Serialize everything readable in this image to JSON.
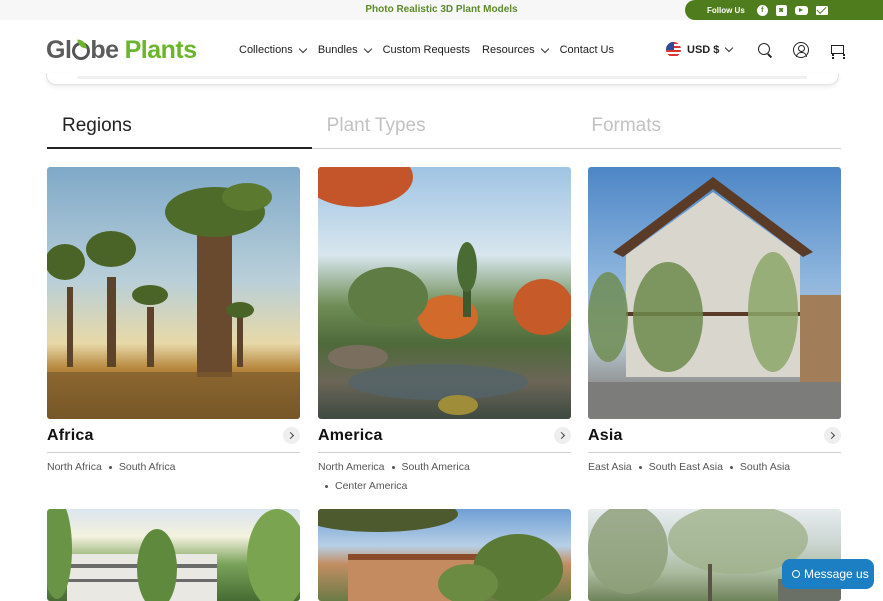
{
  "topbar": {
    "promo": "Photo Realistic 3D Plant Models",
    "follow_label": "Follow Us",
    "social": [
      "facebook-icon",
      "instagram-icon",
      "youtube-icon",
      "mail-icon"
    ]
  },
  "header": {
    "logo_left": "Gl",
    "logo_mid": "be",
    "logo_right": "Plants",
    "nav": [
      {
        "label": "Collections",
        "dropdown": true
      },
      {
        "label": "Bundles",
        "dropdown": true
      },
      {
        "label": "Custom Requests",
        "dropdown": false
      },
      {
        "label": "Resources",
        "dropdown": true
      },
      {
        "label": "Contact Us",
        "dropdown": false
      }
    ],
    "currency": "USD $"
  },
  "tabs": [
    "Regions",
    "Plant Types",
    "Formats"
  ],
  "active_tab": "Regions",
  "regions": [
    {
      "title": "Africa",
      "subs": [
        "North Africa",
        "South Africa"
      ]
    },
    {
      "title": "America",
      "subs": [
        "North America",
        "South America",
        "Center America"
      ]
    },
    {
      "title": "Asia",
      "subs": [
        "East Asia",
        "South East Asia",
        "South Asia"
      ]
    }
  ],
  "chat": {
    "label": "Message us"
  },
  "colors": {
    "brand_green": "#6bb52c",
    "topbar_green": "#4f7d1e",
    "chat_blue": "#1c7fc4"
  }
}
